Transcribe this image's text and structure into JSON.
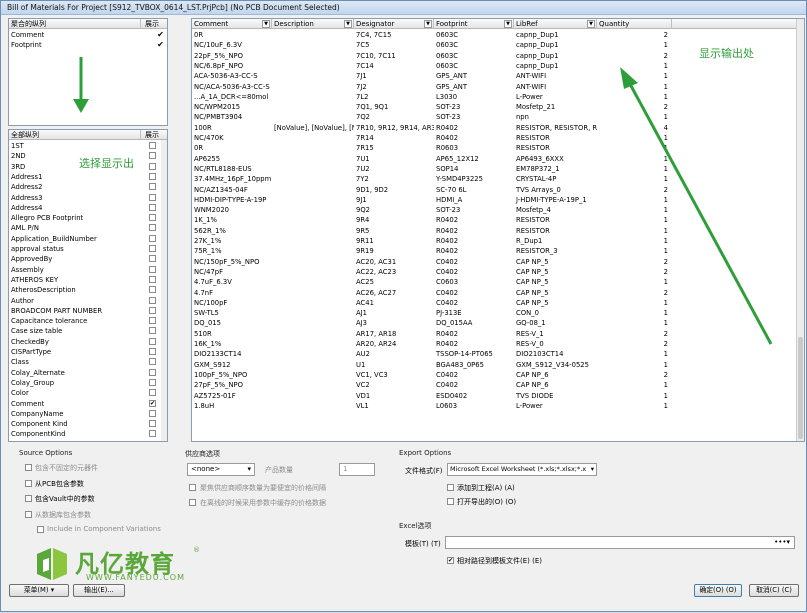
{
  "title": "Bill of Materials For Project [S912_TVBOX_0614_LST.PrjPcb] (No PCB Document Selected)",
  "groups": {
    "header": "聚合的纵列",
    "show": "展示",
    "items": [
      {
        "label": "Comment",
        "checked": true
      },
      {
        "label": "Footprint",
        "checked": true
      }
    ]
  },
  "allcols": {
    "header": "全部纵列",
    "show": "展示",
    "items": [
      {
        "label": "1ST",
        "checked": false
      },
      {
        "label": "2ND",
        "checked": false
      },
      {
        "label": "3RD",
        "checked": false
      },
      {
        "label": "Address1",
        "checked": false
      },
      {
        "label": "Address2",
        "checked": false
      },
      {
        "label": "Address3",
        "checked": false
      },
      {
        "label": "Address4",
        "checked": false
      },
      {
        "label": "Allegro PCB Footprint",
        "checked": false
      },
      {
        "label": "AML P/N",
        "checked": false
      },
      {
        "label": "Application_BuildNumber",
        "checked": false
      },
      {
        "label": "approval status",
        "checked": false
      },
      {
        "label": "ApprovedBy",
        "checked": false
      },
      {
        "label": "Assembly",
        "checked": false
      },
      {
        "label": "ATHEROS KEY",
        "checked": false
      },
      {
        "label": "AtherosDescription",
        "checked": false
      },
      {
        "label": "Author",
        "checked": false
      },
      {
        "label": "BROADCOM PART NUMBER",
        "checked": false
      },
      {
        "label": "Capacitance tolerance",
        "checked": false
      },
      {
        "label": "Case size table",
        "checked": false
      },
      {
        "label": "CheckedBy",
        "checked": false
      },
      {
        "label": "CISPartType",
        "checked": false
      },
      {
        "label": "Class",
        "checked": false
      },
      {
        "label": "Colay_Alternate",
        "checked": false
      },
      {
        "label": "Colay_Group",
        "checked": false
      },
      {
        "label": "Color",
        "checked": false
      },
      {
        "label": "Comment",
        "checked": true
      },
      {
        "label": "CompanyName",
        "checked": false
      },
      {
        "label": "Component Kind",
        "checked": false
      },
      {
        "label": "ComponentKind",
        "checked": false
      }
    ]
  },
  "table": {
    "columns": [
      "Comment",
      "Description",
      "Designator",
      "Footprint",
      "LibRef",
      "Quantity"
    ],
    "rows": [
      [
        "0R",
        "",
        "7C4, 7C15",
        "0603C",
        "capnp_Dup1",
        "2"
      ],
      [
        "NC/10uF_6.3V",
        "",
        "7C5",
        "0603C",
        "capnp_Dup1",
        "1"
      ],
      [
        "22pF_5%_NPO",
        "",
        "7C10, 7C11",
        "0603C",
        "capnp_Dup1",
        "2"
      ],
      [
        "NC/6.8pF_NPO",
        "",
        "7C14",
        "0603C",
        "capnp_Dup1",
        "1"
      ],
      [
        "ACA-5036-A3-CC-S",
        "",
        "7J1",
        "GPS_ANT",
        "ANT-WIFI",
        "1"
      ],
      [
        "NC/ACA-5036-A3-CC-S",
        "",
        "7J2",
        "GPS_ANT",
        "ANT-WIFI",
        "1"
      ],
      [
        "...A_1A_DCR<=80mol",
        "",
        "7L2",
        "L3030",
        "L-Power",
        "1"
      ],
      [
        "NC/WPM2015",
        "",
        "7Q1, 9Q1",
        "SOT-23",
        "Mosfetp_21",
        "2"
      ],
      [
        "NC/PMBT3904",
        "",
        "7Q2",
        "SOT-23",
        "npn",
        "1"
      ],
      [
        "100R",
        "[NoValue], [NoValue], [N",
        "7R10, 9R12, 9R14, AR37",
        "R0402",
        "RESISTOR, RESISTOR, RE",
        "4"
      ],
      [
        "NC/470K",
        "",
        "7R14",
        "R0402",
        "RESISTOR",
        "1"
      ],
      [
        "0R",
        "",
        "7R15",
        "R0603",
        "RESISTOR",
        "1"
      ],
      [
        "AP6255",
        "",
        "7U1",
        "AP65_12X12",
        "AP6493_6XXX",
        "1"
      ],
      [
        "NC/RTL8188-EUS",
        "",
        "7U2",
        "SOP14",
        "EM78P372_1",
        "1"
      ],
      [
        "37.4MHz_16pF_10ppm",
        "",
        "7Y2",
        "Y-SMD4P3225",
        "CRYSTAL-4P",
        "1"
      ],
      [
        "NC/AZ1345-04F",
        "",
        "9D1, 9D2",
        "SC-70 6L",
        "TVS Arrays_0",
        "2"
      ],
      [
        "HDMI-DIP-TYPE-A-19P",
        "",
        "9J1",
        "HDMI_A",
        "J-HDMI-TYPE-A-19P_1",
        "1"
      ],
      [
        "WNM2020",
        "",
        "9Q2",
        "SOT-23",
        "Mosfetp_4",
        "1"
      ],
      [
        "1K_1%",
        "",
        "9R4",
        "R0402",
        "RESISTOR",
        "1"
      ],
      [
        "562R_1%",
        "",
        "9R5",
        "R0402",
        "RESISTOR",
        "1"
      ],
      [
        "27K_1%",
        "",
        "9R11",
        "R0402",
        "R_Dup1",
        "1"
      ],
      [
        "75R_1%",
        "",
        "9R19",
        "R0402",
        "RESISTOR_3",
        "1"
      ],
      [
        "NC/150pF_5%_NPO",
        "",
        "AC20, AC31",
        "C0402",
        "CAP NP_5",
        "2"
      ],
      [
        "NC/47pF",
        "",
        "AC22, AC23",
        "C0402",
        "CAP NP_5",
        "2"
      ],
      [
        "4.7uF_6.3V",
        "",
        "AC25",
        "C0603",
        "CAP NP_5",
        "1"
      ],
      [
        "4.7nF",
        "",
        "AC26, AC27",
        "C0402",
        "CAP NP_5",
        "2"
      ],
      [
        "NC/100pF",
        "",
        "AC41",
        "C0402",
        "CAP NP_5",
        "1"
      ],
      [
        "SW-TL5",
        "",
        "AJ1",
        "PJ-313E",
        "CON_0",
        "1"
      ],
      [
        "DQ_015",
        "",
        "AJ3",
        "DQ_015AA",
        "GQ-08_1",
        "1"
      ],
      [
        "510R",
        "",
        "AR17, AR18",
        "R0402",
        "RES-V_1",
        "2"
      ],
      [
        "16K_1%",
        "",
        "AR20, AR24",
        "R0402",
        "RES-V_0",
        "2"
      ],
      [
        "DIO2133CT14",
        "",
        "AU2",
        "TSSOP-14-PT065",
        "DIO2103CT14",
        "1"
      ],
      [
        "GXM_S912",
        "",
        "U1",
        "BGA483_0P65",
        "GXM_S912_V34-0525",
        "1"
      ],
      [
        "100pF_5%_NPO",
        "",
        "VC1, VC3",
        "C0402",
        "CAP NP_6",
        "2"
      ],
      [
        "27pF_5%_NPO",
        "",
        "VC2",
        "C0402",
        "CAP NP_6",
        "1"
      ],
      [
        "AZ5725-01F",
        "",
        "VD1",
        "ESD0402",
        "TVS DIODE",
        "1"
      ],
      [
        "1.8uH",
        "",
        "VL1",
        "L0603",
        "L-Power",
        "1"
      ]
    ]
  },
  "annot": {
    "output": "显示输出处",
    "select": "选择显示出"
  },
  "source": {
    "title": "Source Options",
    "items": [
      {
        "label": "包含不固定的元器件",
        "checked": false,
        "enabled": false
      },
      {
        "label": "从PCB包含参数",
        "checked": false,
        "enabled": true
      },
      {
        "label": "包含Vault中的参数",
        "checked": false,
        "enabled": true
      },
      {
        "label": "从数据库包含参数",
        "checked": false,
        "enabled": false
      },
      {
        "label": "Include in Component Variations",
        "checked": false,
        "enabled": false
      }
    ]
  },
  "supplier": {
    "title": "供应商选项",
    "select": "<none>",
    "qty_label": "产品数量",
    "qty": "1",
    "opt1": "聚焦供应商顺序数量为要便宜的价格间隔",
    "opt2": "在离线的时候采用参数中缓存的价格数据"
  },
  "export": {
    "title": "Export Options",
    "format_label": "文件格式(F)",
    "format": "Microsoft Excel Worksheet (*.xls;*.xlsx;*.x",
    "add": "添加到工程(A) (A)",
    "open": "打开导出的(O) (O)",
    "excel_title": "Excel选项",
    "template_label": "模板(T) (T)",
    "template": "",
    "relative": "相对路径到模板文件(E) (E)"
  },
  "logo": {
    "text": "凡亿教育",
    "url": "WWW.FANYEDU.COM",
    "reg": "®"
  },
  "buttons": {
    "menu": "菜单(M)",
    "export": "输出(E)...",
    "ok": "确定(O) (O)",
    "cancel": "取消(C) (C)"
  }
}
